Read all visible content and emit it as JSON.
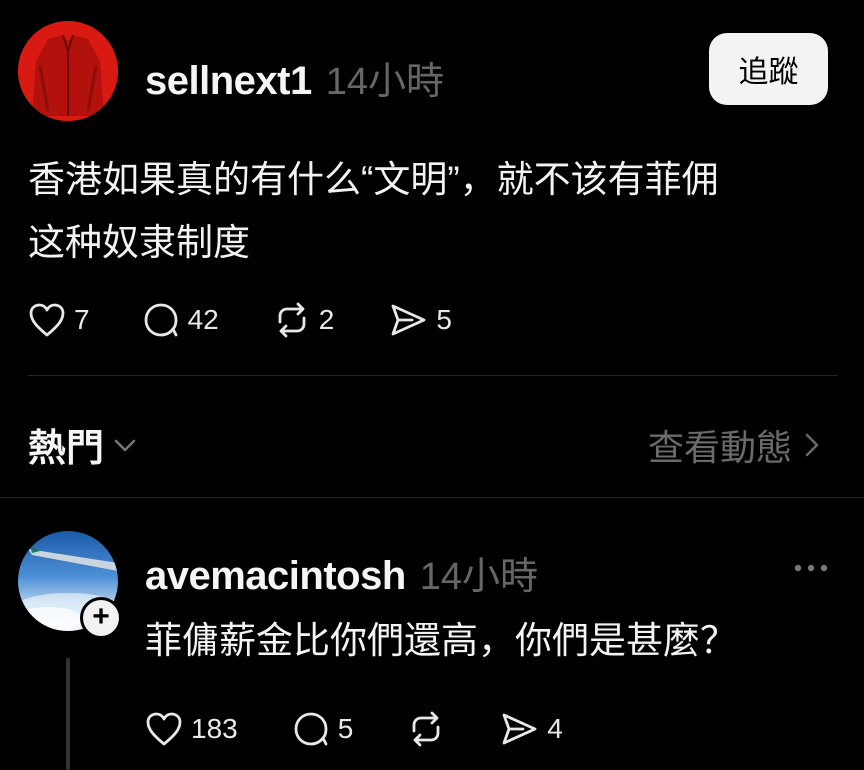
{
  "post": {
    "username": "sellnext1",
    "timestamp": "14小時",
    "follow_label": "追蹤",
    "text_line1": "香港如果真的有什么“文明”，就不该有菲佣",
    "text_line2": "这种奴隶制度",
    "likes": "7",
    "comments": "42",
    "reposts": "2",
    "shares": "5"
  },
  "section": {
    "sort_label": "熱門",
    "view_activity_label": "查看動態"
  },
  "reply": {
    "username": "avemacintosh",
    "timestamp": "14小時",
    "text": "菲傭薪金比你們還高，你們是甚麼？",
    "likes": "183",
    "comments": "5",
    "shares": "4"
  },
  "colors": {
    "background": "#000000",
    "text": "#f3f3f3",
    "muted": "#666666",
    "avatar_main": "#d91a12"
  }
}
